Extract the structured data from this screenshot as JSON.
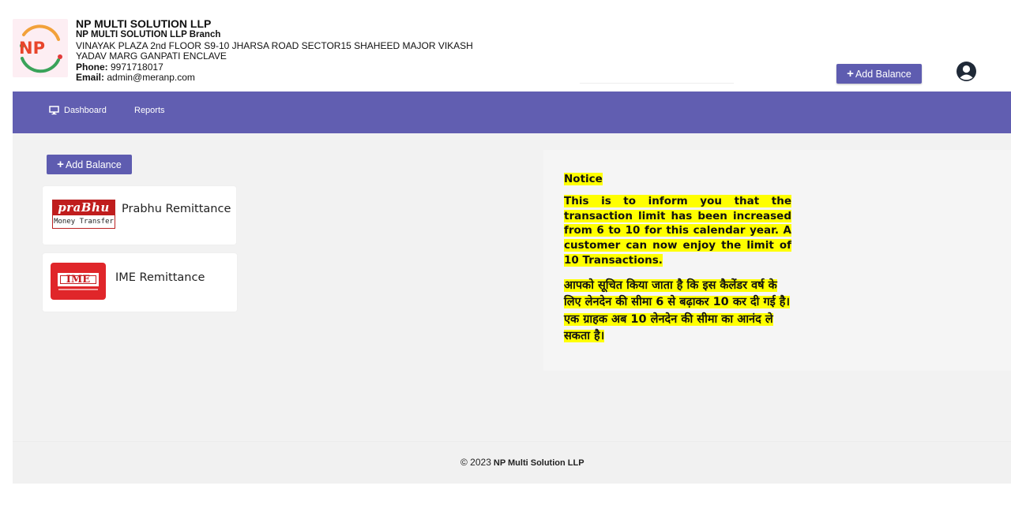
{
  "header": {
    "logo_text": "NP",
    "company_name": "NP MULTI SOLUTION LLP",
    "branch": "NP MULTI SOLUTION LLP Branch",
    "address_line1": "VINAYAK PLAZA 2nd FLOOR S9-10 JHARSA ROAD SECTOR15 SHAHEED MAJOR VIKASH",
    "address_line2": "YADAV MARG GANPATI ENCLAVE",
    "phone_label": "Phone:",
    "phone_value": " 9971718017",
    "email_label": "Email:",
    "email_value": " admin@meranp.com",
    "add_balance_label": "Add Balance"
  },
  "nav": {
    "items": [
      {
        "label": "Dashboard",
        "icon": "monitor-icon"
      },
      {
        "label": "Reports"
      }
    ]
  },
  "main": {
    "add_balance_label": "Add Balance",
    "services": [
      {
        "name": "Prabhu Remittance",
        "logo_top": "praBhu",
        "logo_bottom": "Money Transfer"
      },
      {
        "name": "IME Remittance",
        "logo_text": "IME"
      }
    ]
  },
  "notice": {
    "title": "Notice",
    "english": "This is to inform you that the transaction limit has been increased from 6 to 10 for this calendar year. A customer can now enjoy the limit of 10 Transactions.",
    "hindi": "आपको सूचित किया जाता है कि इस कैलेंडर वर्ष के लिए लेनदेन की सीमा 6 से बढ़ाकर 10 कर दी गई है। एक ग्राहक अब 10 लेनदेन की सीमा का आनंद ले सकता है।",
    "highlight_color": "#ffff00"
  },
  "footer": {
    "copyright": "© 2023",
    "company": "NP Multi Solution LLP"
  },
  "colors": {
    "accent": "#615eb1",
    "button": "#5e5cb0"
  }
}
